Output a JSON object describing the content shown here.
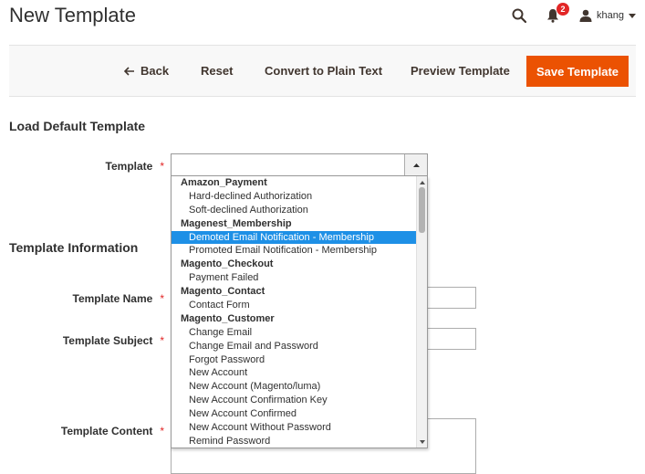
{
  "page": {
    "title": "New Template"
  },
  "header": {
    "notification_count": "2",
    "username": "khang"
  },
  "toolbar": {
    "back_label": "Back",
    "reset_label": "Reset",
    "plain_text_label": "Convert to Plain Text",
    "preview_label": "Preview Template",
    "save_label": "Save Template"
  },
  "load_section": {
    "title": "Load Default Template",
    "template_label": "Template",
    "required_mark": "*",
    "selected_value": ""
  },
  "info_section": {
    "title": "Template Information",
    "name_label": "Template Name",
    "subject_label": "Template Subject",
    "content_label": "Template Content"
  },
  "dropdown": {
    "options": [
      {
        "label": "Amazon_Payment",
        "kind": "group"
      },
      {
        "label": "Hard-declined Authorization",
        "kind": "item"
      },
      {
        "label": "Soft-declined Authorization",
        "kind": "item"
      },
      {
        "label": "Magenest_Membership",
        "kind": "group"
      },
      {
        "label": "Demoted Email Notification - Membership",
        "kind": "item",
        "selected": true
      },
      {
        "label": "Promoted Email Notification - Membership",
        "kind": "item"
      },
      {
        "label": "Magento_Checkout",
        "kind": "group"
      },
      {
        "label": "Payment Failed",
        "kind": "item"
      },
      {
        "label": "Magento_Contact",
        "kind": "group"
      },
      {
        "label": "Contact Form",
        "kind": "item"
      },
      {
        "label": "Magento_Customer",
        "kind": "group"
      },
      {
        "label": "Change Email",
        "kind": "item"
      },
      {
        "label": "Change Email and Password",
        "kind": "item"
      },
      {
        "label": "Forgot Password",
        "kind": "item"
      },
      {
        "label": "New Account",
        "kind": "item"
      },
      {
        "label": "New Account (Magento/luma)",
        "kind": "item"
      },
      {
        "label": "New Account Confirmation Key",
        "kind": "item"
      },
      {
        "label": "New Account Confirmed",
        "kind": "item"
      },
      {
        "label": "New Account Without Password",
        "kind": "item"
      },
      {
        "label": "Remind Password",
        "kind": "item"
      }
    ]
  },
  "colors": {
    "accent": "#eb5202",
    "required": "#e22626",
    "selection": "#1e90e6"
  },
  "icons": [
    "search-icon",
    "bell-icon",
    "user-icon",
    "caret-down-icon",
    "arrow-left-icon",
    "caret-up-icon"
  ]
}
